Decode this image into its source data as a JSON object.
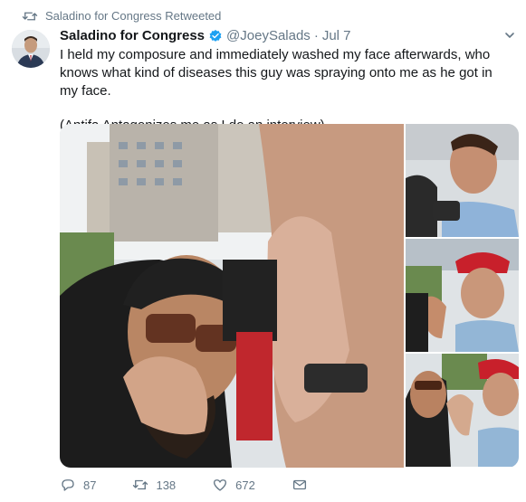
{
  "retweet": {
    "label": "Saladino for Congress Retweeted",
    "icon": "retweet-icon"
  },
  "tweet": {
    "author_name": "Saladino for Congress",
    "verified": true,
    "handle": "@JoeySalads",
    "separator": "·",
    "date": "Jul 7",
    "text_line1": "I held my composure and immediately washed my face afterwards, who knows what kind of diseases this guy was spraying onto me as he got in my face.",
    "text_line2": "(Antifa Antagonizes me as I do an interview)"
  },
  "media": {
    "main": "photo-main",
    "thumbs": [
      "photo-2",
      "photo-3",
      "photo-4"
    ]
  },
  "actions": {
    "reply_count": "87",
    "retweet_count": "138",
    "like_count": "672"
  },
  "colors": {
    "text": "#14171a",
    "muted": "#657786",
    "verified": "#1da1f2"
  }
}
